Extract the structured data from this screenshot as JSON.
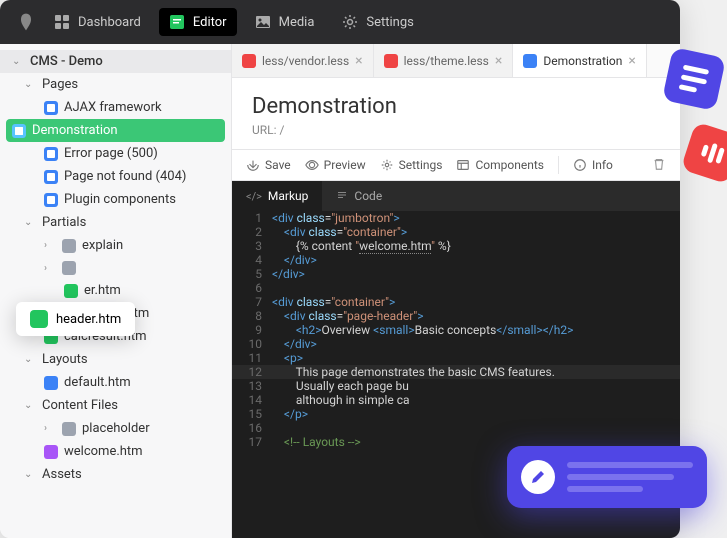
{
  "topnav": {
    "items": [
      {
        "label": "Dashboard"
      },
      {
        "label": "Editor"
      },
      {
        "label": "Media"
      },
      {
        "label": "Settings"
      }
    ]
  },
  "sidebar": {
    "root": "CMS - Demo",
    "sections": {
      "pages": {
        "label": "Pages",
        "items": [
          "AJAX framework",
          "Demonstration",
          "Error page (500)",
          "Page not found (404)",
          "Plugin components"
        ]
      },
      "partials": {
        "label": "Partials",
        "explain": "explain",
        "items_trunc": "er.htm",
        "items": [
          "header.htm",
          "calcresult.htm"
        ]
      },
      "layouts": {
        "label": "Layouts",
        "items": [
          "default.htm"
        ]
      },
      "content": {
        "label": "Content Files",
        "placeholder": "placeholder",
        "items": [
          "welcome.htm"
        ]
      },
      "assets": {
        "label": "Assets"
      }
    }
  },
  "tabs": [
    {
      "label": "less/vendor.less",
      "color": "red"
    },
    {
      "label": "less/theme.less",
      "color": "red"
    },
    {
      "label": "Demonstration",
      "color": "blue"
    }
  ],
  "page": {
    "title": "Demonstration",
    "url_label": "URL: /",
    "toolbar": {
      "save": "Save",
      "preview": "Preview",
      "settings": "Settings",
      "components": "Components",
      "info": "Info"
    }
  },
  "editor_tabs": {
    "markup": "Markup",
    "code": "Code"
  },
  "code_lines": [
    {
      "n": 1,
      "html": "<span class='t-tag'>&lt;div</span> <span class='t-attr'>class</span>=<span class='t-str'>\"jumbotron\"</span><span class='t-tag'>&gt;</span>"
    },
    {
      "n": 2,
      "html": "    <span class='t-tag'>&lt;div</span> <span class='t-attr'>class</span>=<span class='t-str'>\"container\"</span><span class='t-tag'>&gt;</span>"
    },
    {
      "n": 3,
      "html": "        {% content <span class='t-str'>\"<span class='t-link'>welcome.htm</span>\"</span> %}"
    },
    {
      "n": 4,
      "html": "    <span class='t-tag'>&lt;/div&gt;</span>"
    },
    {
      "n": 5,
      "html": "<span class='t-tag'>&lt;/div&gt;</span>"
    },
    {
      "n": 6,
      "html": ""
    },
    {
      "n": 7,
      "html": "<span class='t-tag'>&lt;div</span> <span class='t-attr'>class</span>=<span class='t-str'>\"container\"</span><span class='t-tag'>&gt;</span>"
    },
    {
      "n": 8,
      "html": "    <span class='t-tag'>&lt;div</span> <span class='t-attr'>class</span>=<span class='t-str'>\"page-header\"</span><span class='t-tag'>&gt;</span>"
    },
    {
      "n": 9,
      "html": "        <span class='t-tag'>&lt;h2&gt;</span>Overview <span class='t-tag'>&lt;small&gt;</span>Basic concepts<span class='t-tag'>&lt;/small&gt;&lt;/h2&gt;</span>"
    },
    {
      "n": 10,
      "html": "    <span class='t-tag'>&lt;/div&gt;</span>"
    },
    {
      "n": 11,
      "html": "    <span class='t-tag'>&lt;p&gt;</span>"
    },
    {
      "n": 12,
      "html": "        This page demonstrates the basic CMS features.",
      "hl": true
    },
    {
      "n": 13,
      "html": "        Usually each page bu"
    },
    {
      "n": 14,
      "html": "        although in simple ca"
    },
    {
      "n": 15,
      "html": "    <span class='t-tag'>&lt;/p&gt;</span>"
    },
    {
      "n": 16,
      "html": ""
    },
    {
      "n": 17,
      "html": "    <span class='t-comm'>&lt;!-- Layouts --&gt;</span>"
    }
  ],
  "float_tag": "header.htm"
}
